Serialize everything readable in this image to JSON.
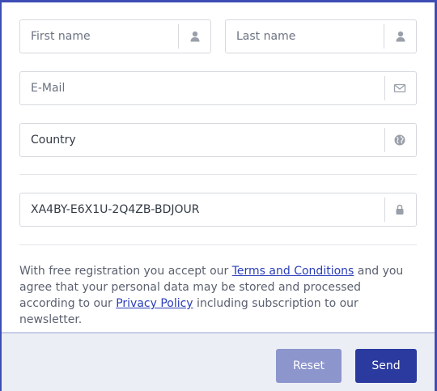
{
  "form": {
    "first_name": {
      "value": "",
      "placeholder": "First name",
      "icon": "user-icon"
    },
    "last_name": {
      "value": "",
      "placeholder": "Last name",
      "icon": "user-icon"
    },
    "email": {
      "value": "",
      "placeholder": "E-Mail",
      "icon": "envelope-icon"
    },
    "country": {
      "value": "Country",
      "placeholder": "",
      "icon": "globe-icon"
    },
    "code": {
      "value": "XA4BY-E6X1U-2Q4ZB-BDJOUR",
      "icon": "lock-icon"
    }
  },
  "legal": {
    "part1": "With free registration you accept our ",
    "terms_link": "Terms and Conditions",
    "part2": " and you agree that your personal data may be stored and processed according to our ",
    "privacy_link": "Privacy Policy",
    "part3": " including subscription to our newsletter."
  },
  "footer": {
    "reset_label": "Reset",
    "send_label": "Send"
  },
  "colors": {
    "accent": "#2b3a9e",
    "reset_button": "#8c95cc",
    "link": "#2a3eb8",
    "footer_bg": "#eceef5"
  }
}
